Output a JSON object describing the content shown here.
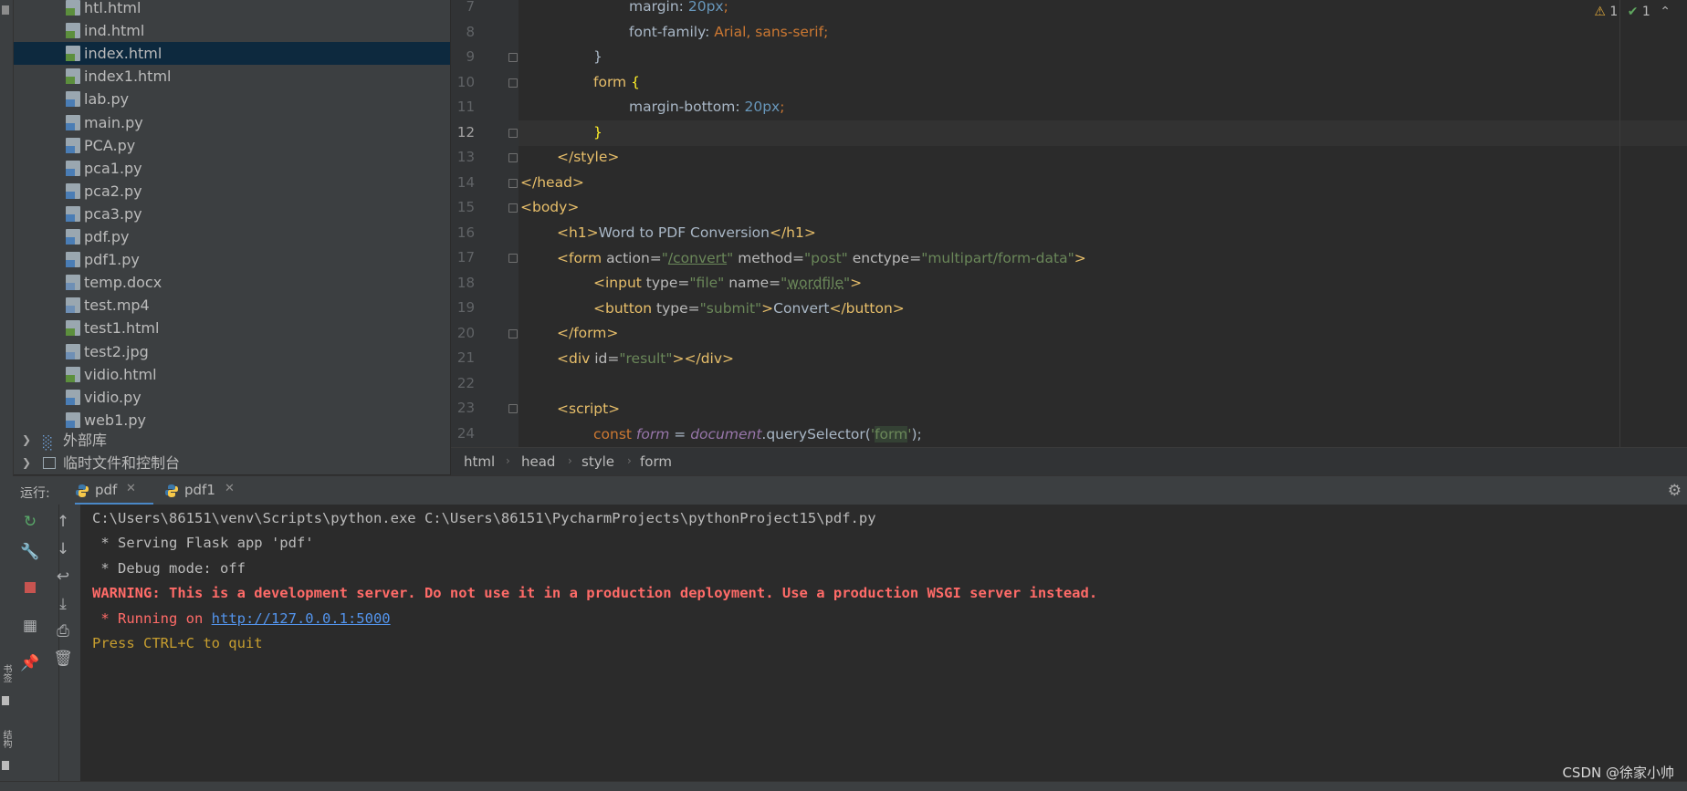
{
  "sidebar_strip": {
    "bookmarks_label": "书签",
    "structure_label": "结构"
  },
  "project_tree": {
    "files": [
      {
        "name": "htl.html",
        "type": "html"
      },
      {
        "name": "ind.html",
        "type": "html"
      },
      {
        "name": "index.html",
        "type": "html",
        "selected": true
      },
      {
        "name": "index1.html",
        "type": "html"
      },
      {
        "name": "lab.py",
        "type": "py"
      },
      {
        "name": "main.py",
        "type": "py"
      },
      {
        "name": "PCA.py",
        "type": "py"
      },
      {
        "name": "pca1.py",
        "type": "py"
      },
      {
        "name": "pca2.py",
        "type": "py"
      },
      {
        "name": "pca3.py",
        "type": "py"
      },
      {
        "name": "pdf.py",
        "type": "py"
      },
      {
        "name": "pdf1.py",
        "type": "py"
      },
      {
        "name": "temp.docx",
        "type": "docx"
      },
      {
        "name": "test.mp4",
        "type": "unknown"
      },
      {
        "name": "test1.html",
        "type": "html"
      },
      {
        "name": "test2.jpg",
        "type": "image"
      },
      {
        "name": "vidio.html",
        "type": "html"
      },
      {
        "name": "vidio.py",
        "type": "py"
      },
      {
        "name": "web1.py",
        "type": "py"
      }
    ],
    "external_libraries": "外部库",
    "scratches": "临时文件和控制台"
  },
  "editor": {
    "current_line": 12,
    "line_numbers": [
      "7",
      "8",
      "9",
      "10",
      "11",
      "12",
      "13",
      "14",
      "15",
      "16",
      "17",
      "18",
      "19",
      "20",
      "21",
      "22",
      "23",
      "24"
    ],
    "code": {
      "l7_prop": "margin: ",
      "l7_num": "20",
      "l7_unit": "px",
      "l7_semi": ";",
      "l8_prop": "font-family: ",
      "l8_val": "Arial",
      "l8_comma": ", ",
      "l8_val2": "sans-serif",
      "l8_semi": ";",
      "l9": "}",
      "l10_sel": "form ",
      "l10_brace": "{",
      "l11_prop": "margin-bottom: ",
      "l11_num": "20",
      "l11_unit": "px",
      "l11_semi": ";",
      "l12": "}",
      "l13": "</style>",
      "l14": "</head>",
      "l15": "<body>",
      "l16_open": "<h1>",
      "l16_text": "Word to PDF Conversion",
      "l16_close": "</h1>",
      "l17_open": "<form ",
      "l17_a1": "action=",
      "l17_v1q": "\"",
      "l17_v1": "/convert",
      "l17_v1q2": "\"",
      "l17_a2": " method=",
      "l17_v2": "\"post\"",
      "l17_a3": " enctype=",
      "l17_v3": "\"multipart/form-data\"",
      "l17_close": ">",
      "l18_open": "<input ",
      "l18_a1": "type=",
      "l18_v1": "\"file\"",
      "l18_a2": " name=",
      "l18_v2q": "\"",
      "l18_v2": "wordfile",
      "l18_v2q2": "\"",
      "l18_close": ">",
      "l19_open": "<button ",
      "l19_a1": "type=",
      "l19_v1": "\"submit\"",
      "l19_gt": ">",
      "l19_text": "Convert",
      "l19_close": "</button>",
      "l20": "</form>",
      "l21_open": "<div ",
      "l21_a1": "id=",
      "l21_v1": "\"result\"",
      "l21_close": "></div>",
      "l22": "",
      "l23": "<script>",
      "l24_kw": "const ",
      "l24_var": "form",
      "l24_eq": " = ",
      "l24_doc": "document",
      "l24_dot": ".querySelector(",
      "l24_q1": "'",
      "l24_str": "form",
      "l24_q2": "'",
      "l24_end": ");"
    },
    "status": {
      "warnings": "1",
      "ok": "1"
    }
  },
  "breadcrumb": [
    "html",
    "head",
    "style",
    "form"
  ],
  "run_panel": {
    "label": "运行:",
    "tabs": [
      {
        "label": "pdf",
        "active": true
      },
      {
        "label": "pdf1",
        "active": false
      }
    ],
    "console": {
      "line1": "C:\\Users\\86151\\venv\\Scripts\\python.exe C:\\Users\\86151\\PycharmProjects\\pythonProject15\\pdf.py",
      "line2": " * Serving Flask app 'pdf'",
      "line3": " * Debug mode: off",
      "line4": "WARNING: This is a development server. Do not use it in a production deployment. Use a production WSGI server instead.",
      "line5_prefix": " * Running on ",
      "line5_url": "http://127.0.0.1:5000",
      "line6": "Press CTRL+C to quit"
    }
  },
  "watermark": "CSDN @徐家小帅",
  "colors": {
    "accent": "#4a88c7",
    "selection": "#0d293e",
    "warning": "#ff6b68",
    "link": "#5394ec"
  }
}
